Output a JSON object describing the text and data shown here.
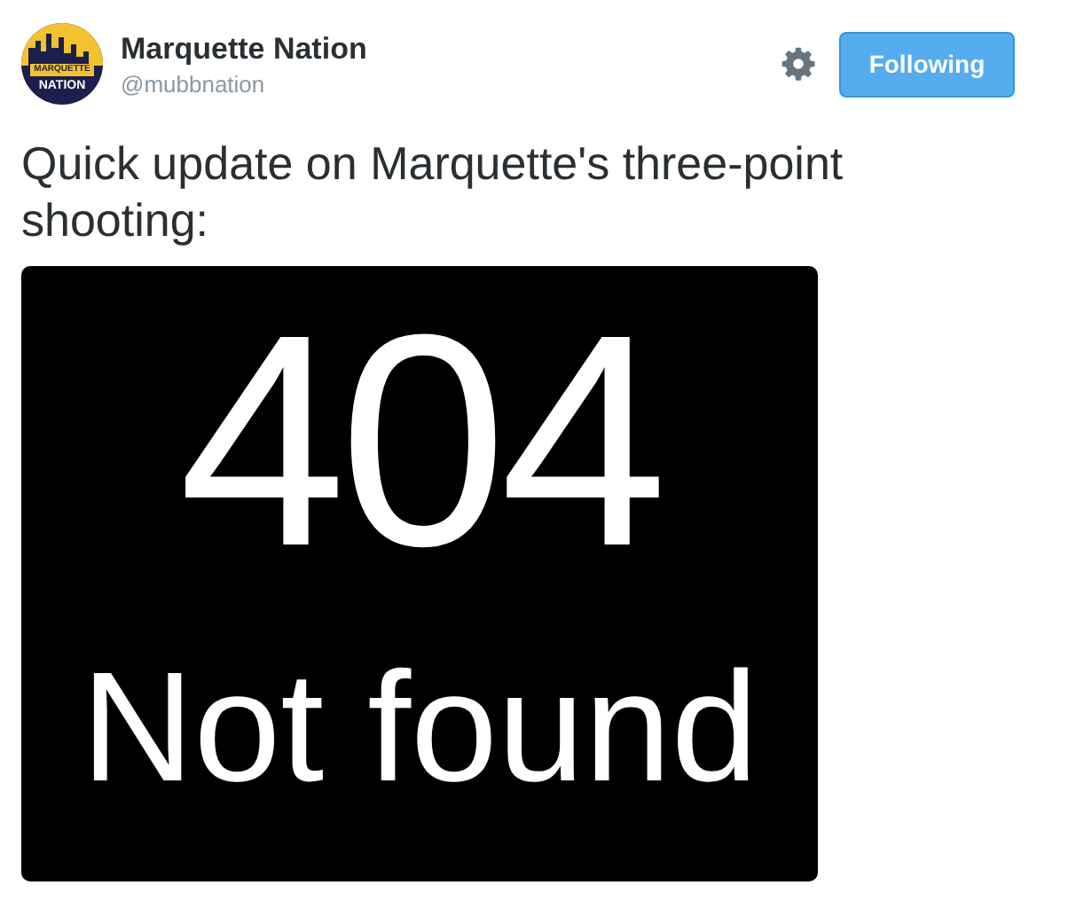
{
  "account": {
    "name": "Marquette Nation",
    "handle": "@mubbnation",
    "avatar_text": [
      "MARQUETTE",
      "NATION"
    ]
  },
  "follow_button": {
    "label": "Following"
  },
  "tweet": {
    "text": "Quick update on Marquette's three-point shooting:"
  },
  "image": {
    "code": "404",
    "message": "Not found"
  }
}
